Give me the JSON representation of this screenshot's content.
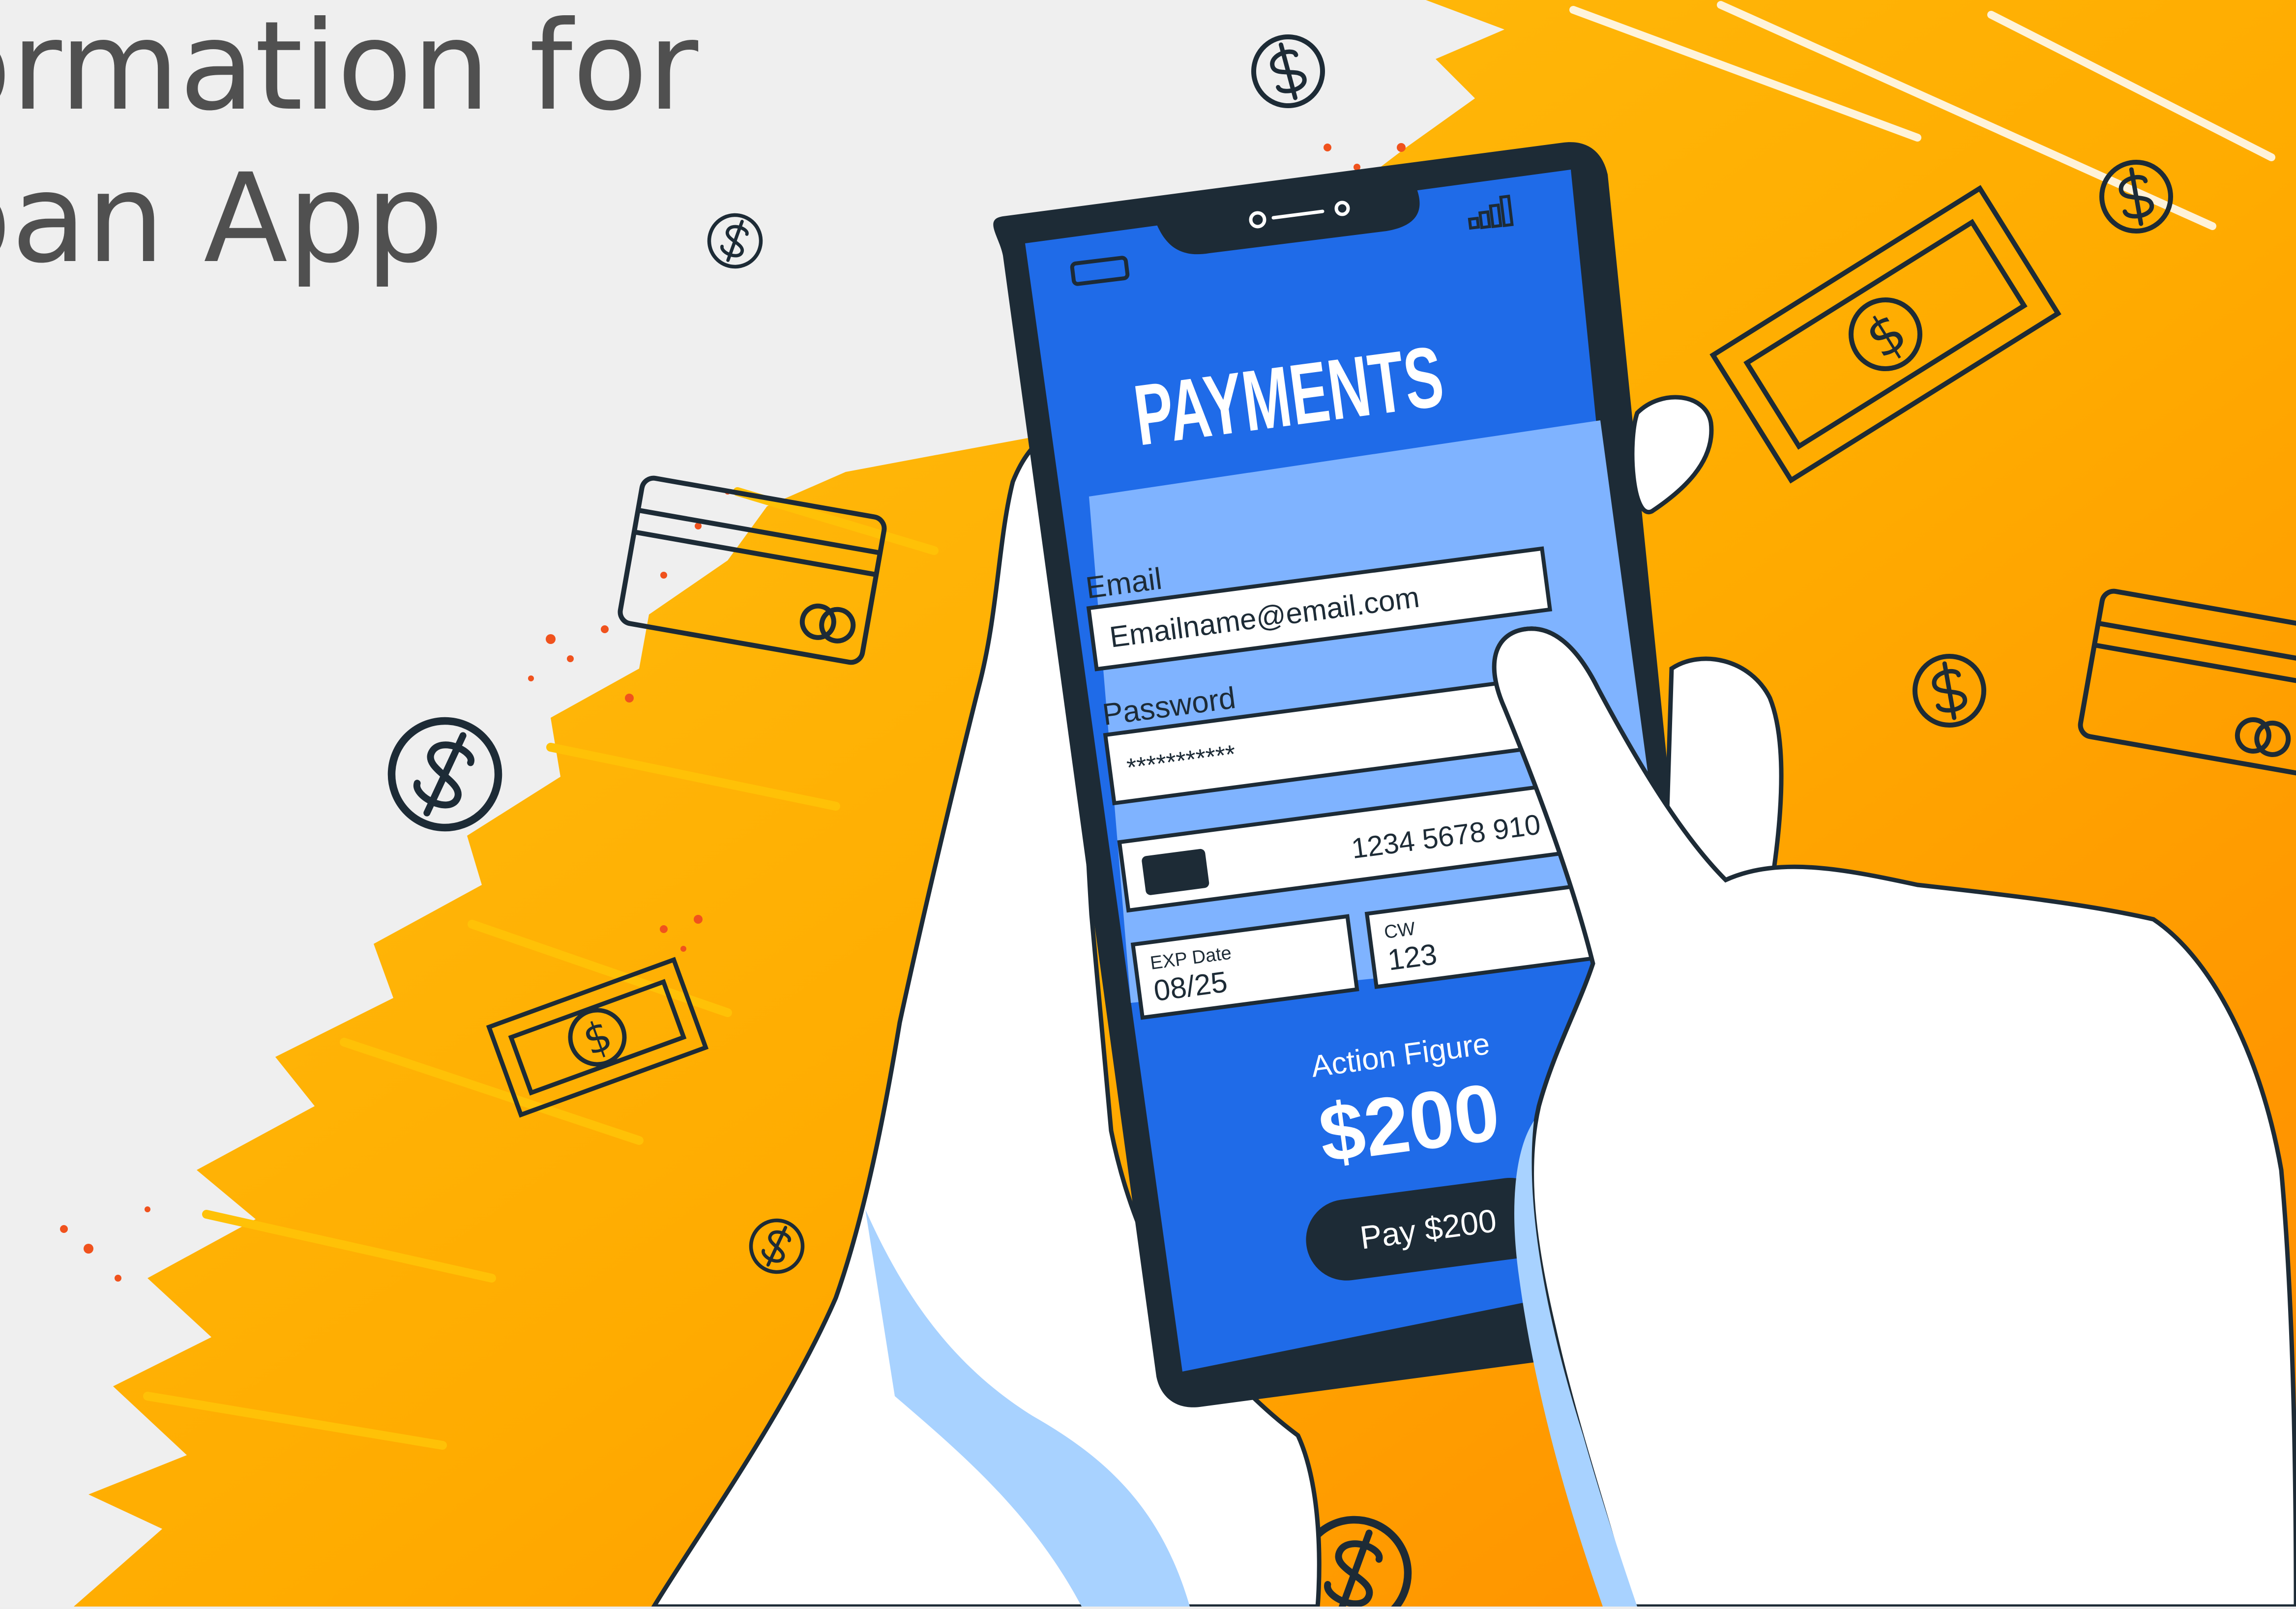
{
  "headline": {
    "line1": "ormation for",
    "line2": "oan App"
  },
  "payment_screen": {
    "title": "PAYMENTS",
    "email_label": "Email",
    "email_value": "Emailname@email.com",
    "password_label": "Password",
    "password_value": "***********",
    "card_number": "1234 5678 910",
    "exp_label": "EXP Date",
    "exp_value": "08/25",
    "cvv_label": "CW",
    "cvv_value": "123",
    "product_name": "Action Figure",
    "amount": "$200",
    "pay_button_label": "Pay $200"
  },
  "icons": {
    "currency_symbol": "$"
  },
  "colors": {
    "background": "#eeeeee",
    "orange_light": "#ffc107",
    "orange_dark": "#ff8a00",
    "phone_body": "#1d2b36",
    "screen_blue": "#1f6be8",
    "form_panel": "#7fb3ff",
    "hand_fill": "#ffffff",
    "hand_shadow": "#a8d2ff",
    "text_dark": "#505050"
  }
}
